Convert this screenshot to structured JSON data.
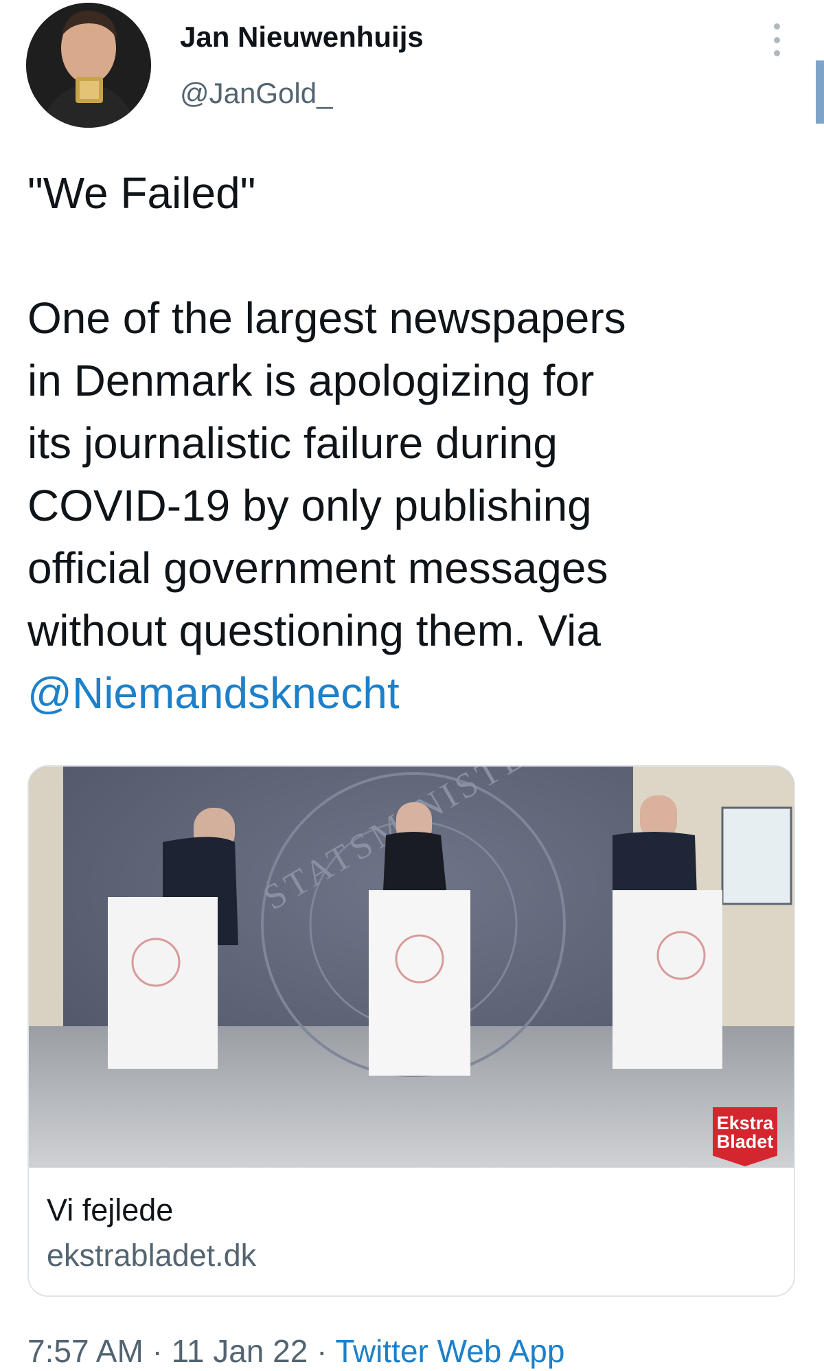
{
  "tweet": {
    "author_name": "Jan Nieuwenhuijs",
    "author_handle": "@JanGold_",
    "text_main": "\"We Failed\"\n\nOne of the largest newspapers\nin Denmark is apologizing for\nits journalistic failure during\nCOVID-19 by only publishing\nofficial government messages\nwithout questioning them. Via\n",
    "mention": "@Niemandsknecht",
    "time": "7:57 AM",
    "separator": " · ",
    "date": "11 Jan 22",
    "source": "Twitter Web App"
  },
  "card": {
    "title": "Vi fejlede",
    "domain": "ekstrabladet.dk",
    "badge_line1": "Ekstra",
    "badge_line2": "Bladet",
    "seal_text": "STATSMINISTERIET"
  },
  "icons": {
    "more": "more-vertical-icon"
  },
  "colors": {
    "link": "#1d80c9",
    "secondary_text": "#536471",
    "badge": "#d4262e"
  }
}
